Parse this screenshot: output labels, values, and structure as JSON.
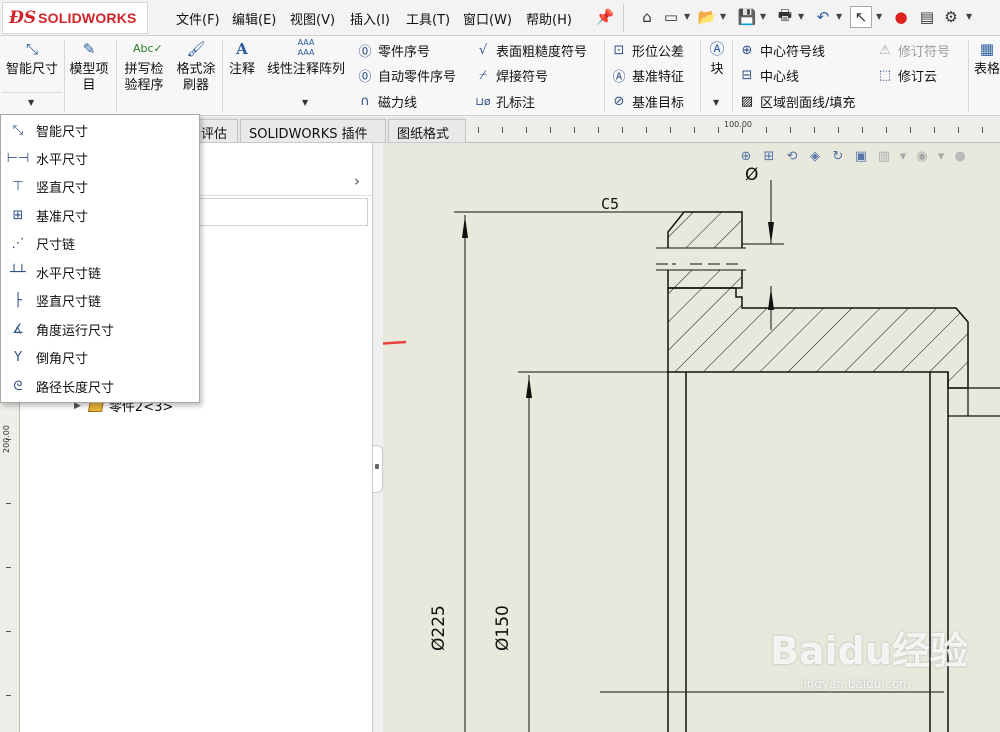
{
  "app": {
    "brand": "SOLIDWORKS",
    "brand_color": "#d2232a"
  },
  "menubar": {
    "items": [
      "文件(F)",
      "编辑(E)",
      "视图(V)",
      "插入(I)",
      "工具(T)",
      "窗口(W)",
      "帮助(H)"
    ],
    "pin_icon": "pin-icon",
    "quick_icons": [
      "home-icon",
      "new-document-icon",
      "open-icon",
      "save-icon",
      "print-icon",
      "undo-icon",
      "select-icon",
      "rebuild-icon",
      "options-icon",
      "settings-icon"
    ]
  },
  "ribbon": {
    "smart_dimension": "智能尺寸",
    "model_items": "模型项目",
    "spell_check": "拼写检验程序",
    "format_painter": "格式涂刷器",
    "note": "注释",
    "linear_pattern": "线性注释阵列",
    "balloon": "零件序号",
    "auto_balloon": "自动零件序号",
    "magnetic_line": "磁力线",
    "surface_finish": "表面粗糙度符号",
    "weld_symbol": "焊接符号",
    "hole_callout": "孔标注",
    "geometric_tolerance": "形位公差",
    "datum_feature": "基准特征",
    "datum_target": "基准目标",
    "block": "块",
    "center_mark": "中心符号线",
    "centerline": "中心线",
    "area_hatch": "区域剖面线/填充",
    "revision_symbol": "修订符号",
    "revision_cloud": "修订云",
    "table": "表格"
  },
  "tabs": {
    "evaluate": "评估",
    "addins": "SOLIDWORKS 插件",
    "sheet_format": "图纸格式"
  },
  "ruler": {
    "h_label": "100.00",
    "v_label": "200.00"
  },
  "tree": {
    "item": "零件2<3>"
  },
  "dropdown": {
    "items": [
      {
        "label": "智能尺寸",
        "icon": "smart-dimension-icon"
      },
      {
        "label": "水平尺寸",
        "icon": "horizontal-dimension-icon"
      },
      {
        "label": "竖直尺寸",
        "icon": "vertical-dimension-icon"
      },
      {
        "label": "基准尺寸",
        "icon": "baseline-dimension-icon"
      },
      {
        "label": "尺寸链",
        "icon": "ordinate-dimension-icon"
      },
      {
        "label": "水平尺寸链",
        "icon": "horizontal-ordinate-icon"
      },
      {
        "label": "竖直尺寸链",
        "icon": "vertical-ordinate-icon"
      },
      {
        "label": "角度运行尺寸",
        "icon": "angular-running-icon"
      },
      {
        "label": "倒角尺寸",
        "icon": "chamfer-dimension-icon"
      },
      {
        "label": "路径长度尺寸",
        "icon": "path-length-icon"
      }
    ],
    "highlight_color": "#e8413c"
  },
  "drawing": {
    "chamfer_label": "C5",
    "dim_225": "Ø225",
    "dim_150": "Ø150",
    "diameter_symbol": "Ø",
    "paper_color": "#e8e8dd",
    "line_color": "#111111"
  },
  "watermark": {
    "text": "Baidu经验",
    "url": "jingyan.baidu.com"
  }
}
